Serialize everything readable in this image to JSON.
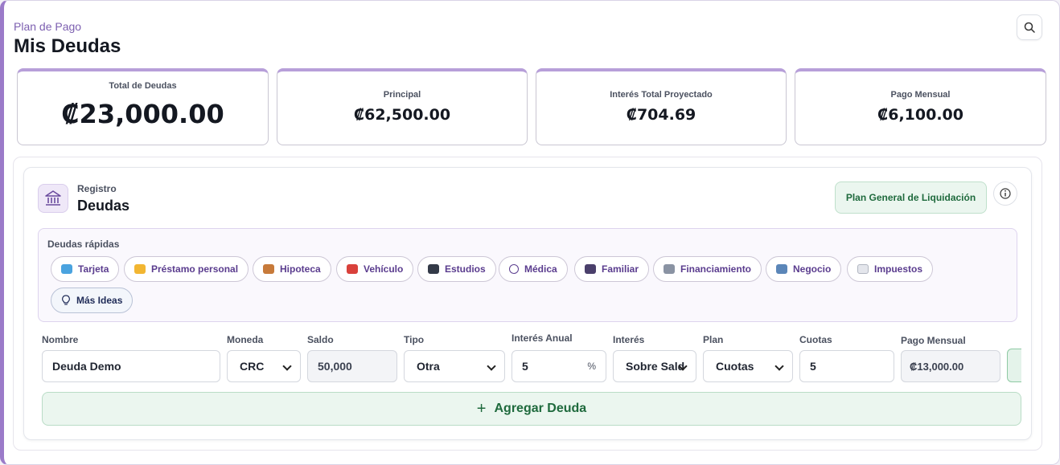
{
  "header": {
    "subtitle": "Plan de Pago",
    "title": "Mis Deudas"
  },
  "summary": [
    {
      "label": "Total de Deudas",
      "value": "₡23,000.00"
    },
    {
      "label": "Principal",
      "value": "₡62,500.00"
    },
    {
      "label": "Interés Total Proyectado",
      "value": "₡704.69"
    },
    {
      "label": "Pago Mensual",
      "value": "₡6,100.00"
    }
  ],
  "registro": {
    "subtitle": "Registro",
    "title": "Deudas",
    "plan_button": "Plan General de Liquidación"
  },
  "quick": {
    "title": "Deudas rápidas",
    "chips": [
      "Tarjeta",
      "Préstamo personal",
      "Hipoteca",
      "Vehículo",
      "Estudios",
      "Médica",
      "Familiar",
      "Financiamiento",
      "Negocio",
      "Impuestos"
    ],
    "more": "Más Ideas"
  },
  "form": {
    "labels": {
      "nombre": "Nombre",
      "moneda": "Moneda",
      "saldo": "Saldo",
      "tipo": "Tipo",
      "interes_anual": "Interés Anual",
      "interes": "Interés",
      "plan": "Plan",
      "cuotas": "Cuotas",
      "pago_mensual": "Pago Mensual"
    },
    "values": {
      "nombre": "Deuda Demo",
      "moneda": "CRC",
      "saldo": "50,000",
      "tipo": "Otra",
      "interes_anual": "5",
      "pct": "%",
      "interes": "Sobre Saldo",
      "plan": "Cuotas",
      "cuotas": "5",
      "pago_mensual": "₡13,000.00"
    },
    "add_button": "Agregar Deuda"
  },
  "colors": {
    "accent": "#9b7bc9",
    "green": "#1f6a3d",
    "chip_text": "#5a3c8e"
  }
}
